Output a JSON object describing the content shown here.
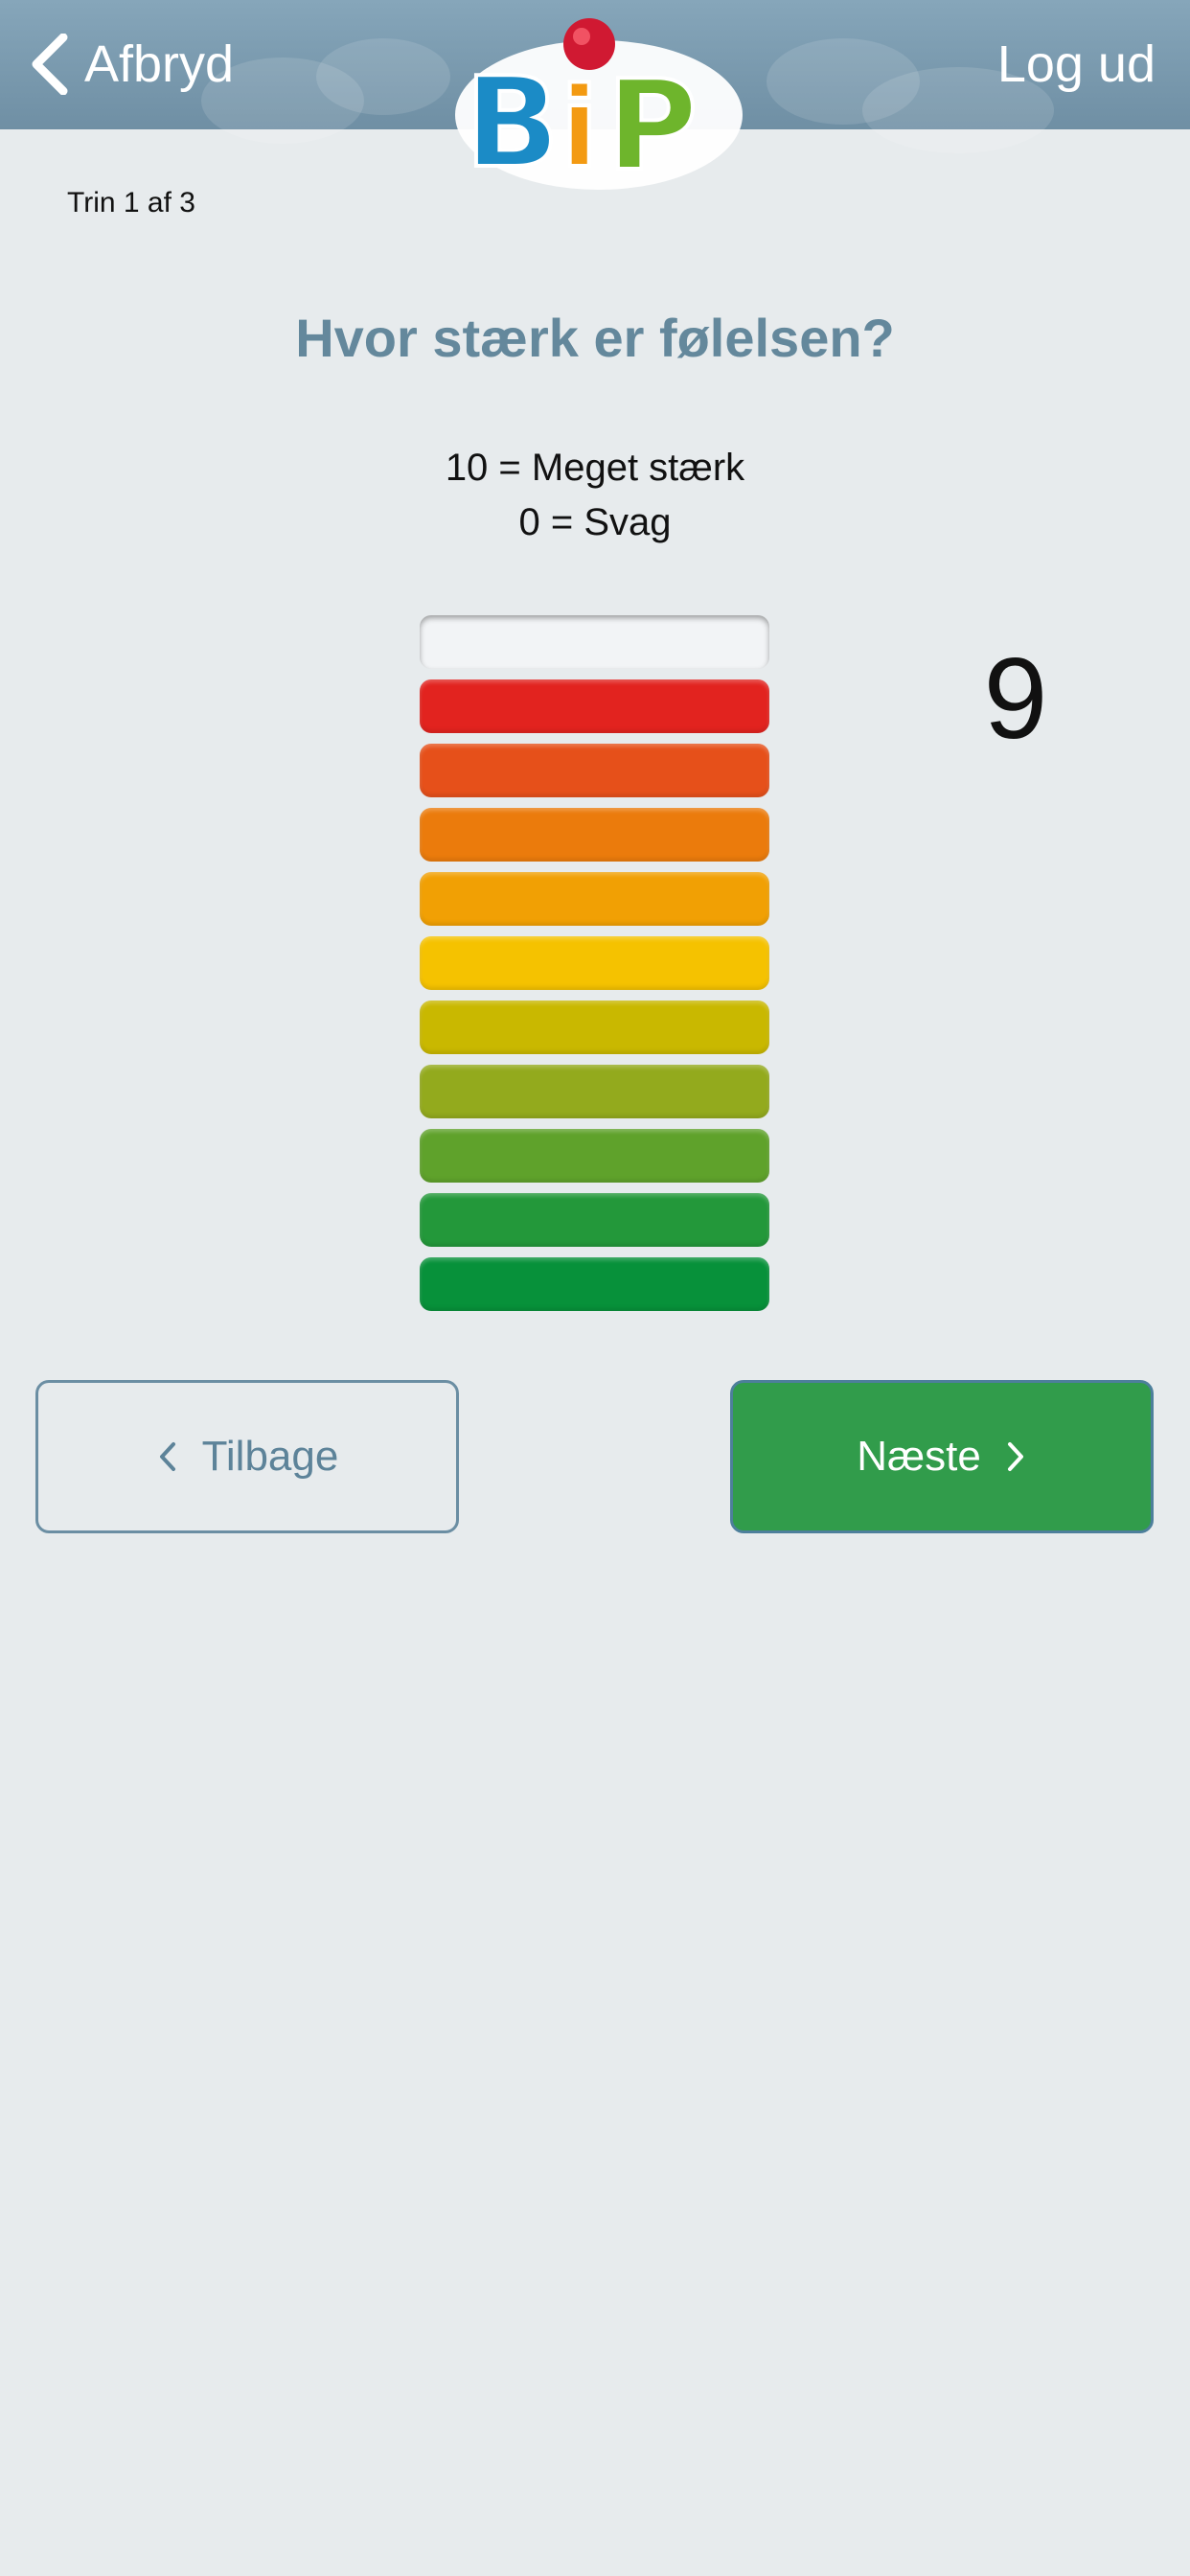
{
  "header": {
    "back_label": "Afbryd",
    "logout_label": "Log ud",
    "logo_text": "BiP"
  },
  "step": {
    "label": "Trin 1 af 3"
  },
  "question": {
    "title": "Hvor stærk er følelsen?",
    "legend_high": "10 = Meget stærk",
    "legend_low": "0 = Svag"
  },
  "scale": {
    "max": 10,
    "selected_value": 9,
    "display_value": "9",
    "levels": [
      {
        "level": 10,
        "color": "#f2f4f6",
        "filled": false
      },
      {
        "level": 9,
        "color": "#e2231f",
        "filled": true
      },
      {
        "level": 8,
        "color": "#e6501a",
        "filled": true
      },
      {
        "level": 7,
        "color": "#eb7b0c",
        "filled": true
      },
      {
        "level": 6,
        "color": "#f1a004",
        "filled": true
      },
      {
        "level": 5,
        "color": "#f5c200",
        "filled": true
      },
      {
        "level": 4,
        "color": "#c9b800",
        "filled": true
      },
      {
        "level": 3,
        "color": "#93aa1d",
        "filled": true
      },
      {
        "level": 2,
        "color": "#5fa22b",
        "filled": true
      },
      {
        "level": 1,
        "color": "#23983a",
        "filled": true
      },
      {
        "level": 0,
        "color": "#07913a",
        "filled": true
      }
    ]
  },
  "navigation": {
    "back_label": "Tilbage",
    "next_label": "Næste"
  },
  "colors": {
    "header": "#7a9aae",
    "background": "#e7ebed",
    "accent_text": "#64889c",
    "next_button": "#319c4b"
  }
}
